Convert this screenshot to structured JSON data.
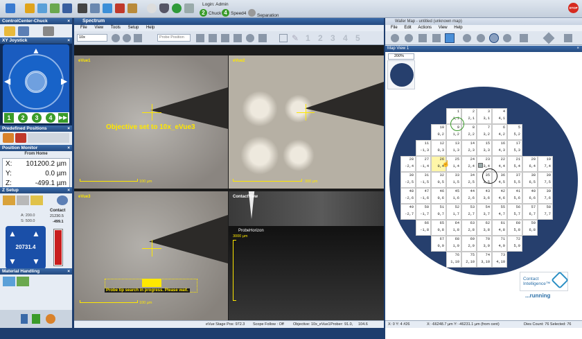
{
  "toolbar": {
    "icons": [
      "pointer-icon",
      "lock-icon",
      "unload-icon",
      "load-icon",
      "save-icon",
      "chuck-icon",
      "setup-icon",
      "stage-icon",
      "flag-icon",
      "contacts-icon",
      "light-icon",
      "magnet-icon",
      "target-icon",
      "grid-icon"
    ],
    "login_label": "Login: Admin",
    "modes": [
      {
        "num": "2",
        "label": "Chuck"
      },
      {
        "num": "4",
        "label": "Speed4"
      },
      {
        "num": "",
        "label": "Separation"
      }
    ],
    "stop_label": "STOP"
  },
  "left": {
    "cc_title": "ControlCenter-Chuck",
    "xy_title": "XY Joystick",
    "speed_buttons": [
      "1",
      "2",
      "3",
      "4"
    ],
    "predef_title": "Predefined Positions",
    "posmon_title": "Position Monitor",
    "from_home": "From Home",
    "positions": [
      {
        "axis": "X:",
        "value": "101200.2 µm"
      },
      {
        "axis": "Y:",
        "value": "0.0 µm"
      },
      {
        "axis": "Z:",
        "value": "-499.1 µm"
      }
    ],
    "zsetup_title": "Z Setup",
    "a_label": "A: 200.0",
    "s_label": "S: 500.0",
    "contact_label": "Contact",
    "contact_value": "21230.5",
    "contact_delta": "-499.1",
    "zpad_value": "20731.4",
    "z_level_pct": 96,
    "material_title": "Material Handling"
  },
  "spectrum": {
    "title": "Spectrum",
    "menu": [
      "File",
      "View",
      "Tools",
      "Setup",
      "Help"
    ],
    "objective_value": "10x",
    "probe_position": "Probe Position",
    "tool_numbers": [
      "1",
      "2",
      "3",
      "4",
      "5"
    ],
    "panes": [
      {
        "label": "eVue1",
        "scale": "100 µm"
      },
      {
        "label": "eVue2",
        "scale": "300 µm"
      },
      {
        "label": "eVue3",
        "scale": "100 µm"
      },
      {
        "label": "ContactView",
        "scale": ""
      }
    ],
    "objective_msg": "Objective set to 10x_eVue3",
    "probe_msg": "Probe tip search in progress. Please wait.",
    "probehorizon_label": "ProbeHorizon",
    "probehorizon_scale": "3000 µm",
    "status": [
      "eVue Stage Pos: 972.3",
      "Scope Follow : Off",
      "Objective: 10x_eVue1",
      "Prober:",
      "91.0,",
      "104.6"
    ]
  },
  "wafer": {
    "title": "Wafer Map - untitled (unknown map)",
    "menu": [
      "File",
      "Edit",
      "Actions",
      "View",
      "Help"
    ],
    "mapview_title": "Map View 1",
    "zoom": "200%",
    "cells": [
      {
        "n": "1",
        "c": "1,1"
      },
      {
        "n": "2",
        "c": "2,1"
      },
      {
        "n": "3",
        "c": "3,1"
      },
      {
        "n": "4",
        "c": "4,1"
      },
      {
        "n": "10",
        "c": "0,2"
      },
      {
        "n": "9",
        "c": "1,2"
      },
      {
        "n": "8",
        "c": "2,2"
      },
      {
        "n": "7",
        "c": "3,2"
      },
      {
        "n": "6",
        "c": "4,2"
      },
      {
        "n": "5",
        "c": "5,2"
      },
      {
        "n": "11",
        "c": "-1,3"
      },
      {
        "n": "12",
        "c": "0,3"
      },
      {
        "n": "13",
        "c": "1,3"
      },
      {
        "n": "14",
        "c": "2,3"
      },
      {
        "n": "15",
        "c": "3,3"
      },
      {
        "n": "16",
        "c": "4,3"
      },
      {
        "n": "17",
        "c": "5,3"
      },
      {
        "n": "28",
        "c": "-2,4"
      },
      {
        "n": "27",
        "c": "-1,4"
      },
      {
        "n": "26",
        "c": "0,4"
      },
      {
        "n": "25",
        "c": "1,4"
      },
      {
        "n": "24",
        "c": "2,4"
      },
      {
        "n": "23",
        "c": "3,4"
      },
      {
        "n": "22",
        "c": "4,4"
      },
      {
        "n": "21",
        "c": "5,4"
      },
      {
        "n": "20",
        "c": "6,4"
      },
      {
        "n": "19",
        "c": "7,4"
      },
      {
        "n": "30",
        "c": "-2,5"
      },
      {
        "n": "31",
        "c": "-1,5"
      },
      {
        "n": "32",
        "c": "0,5"
      },
      {
        "n": "33",
        "c": "1,5"
      },
      {
        "n": "34",
        "c": "2,5"
      },
      {
        "n": "35",
        "c": "3,5"
      },
      {
        "n": "36",
        "c": "4,5"
      },
      {
        "n": "37",
        "c": "5,5"
      },
      {
        "n": "38",
        "c": "6,5"
      },
      {
        "n": "39",
        "c": "7,5"
      },
      {
        "n": "48",
        "c": "-2,6"
      },
      {
        "n": "47",
        "c": "-1,6"
      },
      {
        "n": "46",
        "c": "0,6"
      },
      {
        "n": "45",
        "c": "1,6"
      },
      {
        "n": "44",
        "c": "2,6"
      },
      {
        "n": "43",
        "c": "3,6"
      },
      {
        "n": "42",
        "c": "4,6"
      },
      {
        "n": "41",
        "c": "5,6"
      },
      {
        "n": "40",
        "c": "6,6"
      },
      {
        "n": "39",
        "c": "7,6"
      },
      {
        "n": "49",
        "c": "-2,7"
      },
      {
        "n": "50",
        "c": "-1,7"
      },
      {
        "n": "51",
        "c": "0,7"
      },
      {
        "n": "52",
        "c": "1,7"
      },
      {
        "n": "53",
        "c": "2,7"
      },
      {
        "n": "54",
        "c": "3,7"
      },
      {
        "n": "55",
        "c": "4,7"
      },
      {
        "n": "56",
        "c": "5,7"
      },
      {
        "n": "57",
        "c": "6,7"
      },
      {
        "n": "58",
        "c": "7,7"
      },
      {
        "n": "66",
        "c": "-1,8"
      },
      {
        "n": "65",
        "c": "0,8"
      },
      {
        "n": "64",
        "c": "1,8"
      },
      {
        "n": "63",
        "c": "2,8"
      },
      {
        "n": "62",
        "c": "3,8"
      },
      {
        "n": "61",
        "c": "4,8"
      },
      {
        "n": "60",
        "c": "5,8"
      },
      {
        "n": "59",
        "c": "6,8"
      },
      {
        "n": "67",
        "c": "0,9"
      },
      {
        "n": "68",
        "c": "1,9"
      },
      {
        "n": "69",
        "c": "2,9"
      },
      {
        "n": "70",
        "c": "3,9"
      },
      {
        "n": "71",
        "c": "4,9"
      },
      {
        "n": "72",
        "c": "5,9"
      },
      {
        "n": "76",
        "c": "1,10"
      },
      {
        "n": "75",
        "c": "2,10"
      },
      {
        "n": "74",
        "c": "3,10"
      },
      {
        "n": "73",
        "c": "4,10"
      }
    ],
    "ci_brand": "Contact Intelligence™",
    "running": "...running",
    "status_left": "X: 0 Y: 4 #26",
    "status_mid": "X: -66248.7 µm Y: -46231.1 µm (from cent)",
    "status_right": "Dies Count: 76 Selected: 76"
  }
}
